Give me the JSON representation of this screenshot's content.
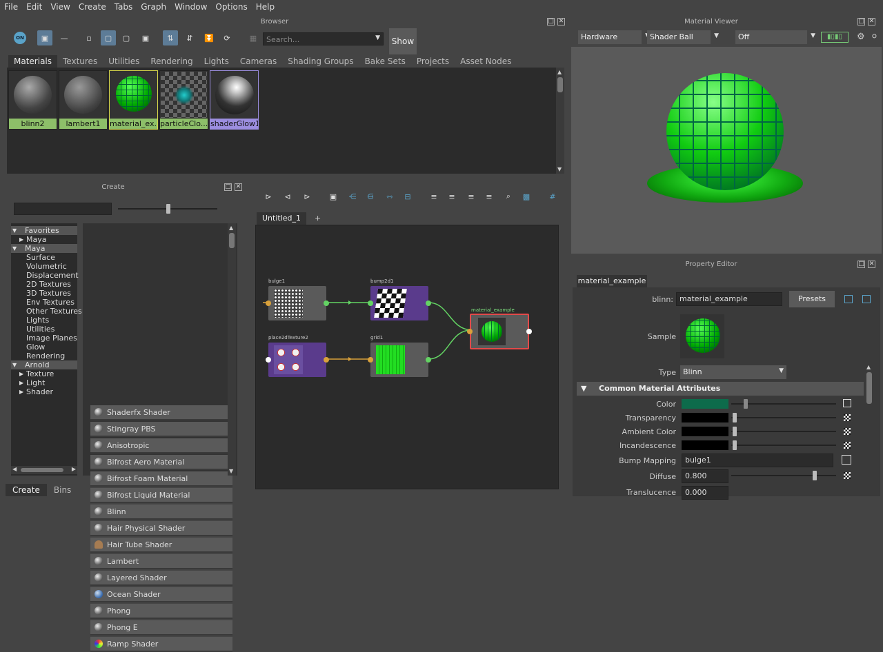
{
  "menu": [
    "File",
    "Edit",
    "View",
    "Create",
    "Tabs",
    "Graph",
    "Window",
    "Options",
    "Help"
  ],
  "browser": {
    "title": "Browser",
    "search_placeholder": "Search...",
    "show_label": "Show",
    "tabs": [
      "Materials",
      "Textures",
      "Utilities",
      "Rendering",
      "Lights",
      "Cameras",
      "Shading Groups",
      "Bake Sets",
      "Projects",
      "Asset Nodes"
    ],
    "materials": [
      "blinn2",
      "lambert1",
      "material_ex...",
      "particleClo...",
      "shaderGlow1"
    ]
  },
  "material_viewer": {
    "title": "Material Viewer",
    "renderer": "Hardware",
    "shape": "Shader Ball",
    "env": "Off"
  },
  "create_panel": {
    "title": "Create",
    "tree": [
      {
        "label": "Favorites",
        "level": 0,
        "arrow": "down"
      },
      {
        "label": "Maya",
        "level": 1,
        "arrow": "right"
      },
      {
        "label": "Maya",
        "level": 0,
        "arrow": "down"
      },
      {
        "label": "Surface",
        "level": 2
      },
      {
        "label": "Volumetric",
        "level": 2
      },
      {
        "label": "Displacement",
        "level": 2
      },
      {
        "label": "2D Textures",
        "level": 2
      },
      {
        "label": "3D Textures",
        "level": 2
      },
      {
        "label": "Env Textures",
        "level": 2
      },
      {
        "label": "Other Textures",
        "level": 2
      },
      {
        "label": "Lights",
        "level": 2
      },
      {
        "label": "Utilities",
        "level": 2
      },
      {
        "label": "Image Planes",
        "level": 2
      },
      {
        "label": "Glow",
        "level": 2
      },
      {
        "label": "Rendering",
        "level": 2
      },
      {
        "label": "Arnold",
        "level": 0,
        "arrow": "down"
      },
      {
        "label": "Texture",
        "level": 1,
        "arrow": "right"
      },
      {
        "label": "Light",
        "level": 1,
        "arrow": "right"
      },
      {
        "label": "Shader",
        "level": 1,
        "arrow": "right"
      }
    ],
    "shaders": [
      "Shaderfx Shader",
      "Stingray PBS",
      "Anisotropic",
      "Bifrost Aero Material",
      "Bifrost Foam Material",
      "Bifrost Liquid Material",
      "Blinn",
      "Hair Physical Shader",
      "Hair Tube Shader",
      "Lambert",
      "Layered Shader",
      "Ocean Shader",
      "Phong",
      "Phong E",
      "Ramp Shader"
    ],
    "bottom_tabs": [
      "Create",
      "Bins"
    ]
  },
  "graph": {
    "tab": "Untitled_1",
    "add_tab": "+",
    "nodes": {
      "bulge": "bulge1",
      "bump": "bump2d1",
      "place": "place2dTexture2",
      "grid": "grid1",
      "material": "material_example"
    }
  },
  "property_editor": {
    "title": "Property Editor",
    "tab": "material_example",
    "node_type_label": "blinn:",
    "node_name": "material_example",
    "presets_label": "Presets",
    "sample_label": "Sample",
    "type_label": "Type",
    "type_value": "Blinn",
    "section": "Common Material Attributes",
    "attrs": {
      "color": "Color",
      "transparency": "Transparency",
      "ambient": "Ambient Color",
      "incandescence": "Incandescence",
      "bump": "Bump Mapping",
      "bump_value": "bulge1",
      "diffuse": "Diffuse",
      "diffuse_value": "0.800",
      "translucence": "Translucence",
      "translucence_value": "0.000"
    },
    "colors": {
      "color_swatch": "#0d6b4b"
    }
  }
}
